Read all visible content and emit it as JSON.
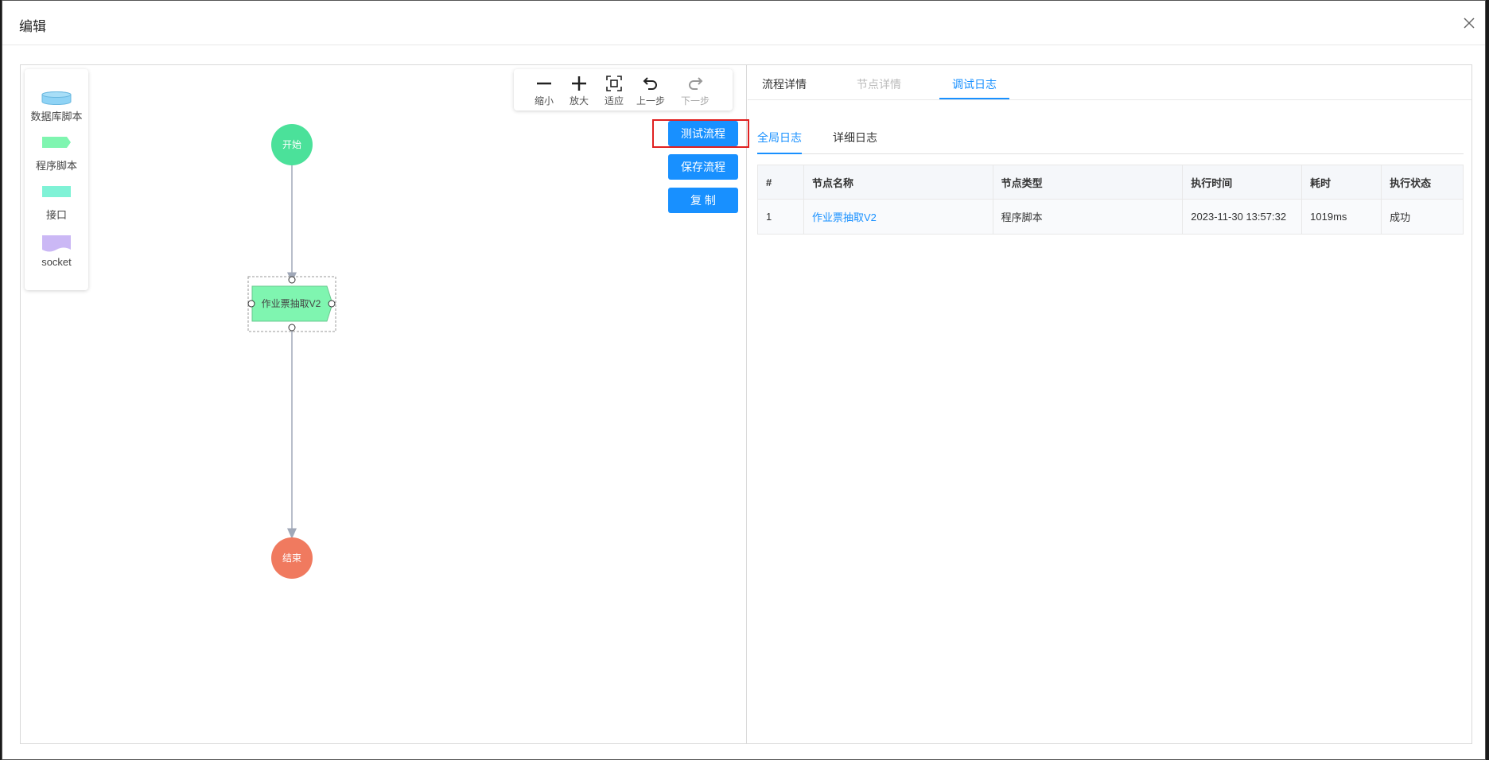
{
  "dialog": {
    "title": "编辑"
  },
  "palette": {
    "items": [
      {
        "label": "数据库脚本",
        "icon": "database-icon"
      },
      {
        "label": "程序脚本",
        "icon": "program-script-icon"
      },
      {
        "label": "接口",
        "icon": "interface-icon"
      },
      {
        "label": "socket",
        "icon": "socket-icon"
      }
    ]
  },
  "toolbar": {
    "zoom_out": "缩小",
    "zoom_in": "放大",
    "fit": "适应",
    "undo": "上一步",
    "redo": "下一步"
  },
  "actions": {
    "test_flow": "测试流程",
    "save_flow": "保存流程",
    "copy": "复 制"
  },
  "flow": {
    "start_label": "开始",
    "task_label": "作业票抽取V2",
    "end_label": "结束",
    "colors": {
      "start": "#4be19a",
      "task": "#7ff5b0",
      "end": "#f07a5f",
      "edge": "#a0a8b8"
    }
  },
  "panel": {
    "tabs": [
      "流程详情",
      "节点详情",
      "调试日志"
    ],
    "subtabs": [
      "全局日志",
      "详细日志"
    ],
    "table": {
      "headers": [
        "#",
        "节点名称",
        "节点类型",
        "执行时间",
        "耗时",
        "执行状态"
      ],
      "rows": [
        [
          "1",
          "作业票抽取V2",
          "程序脚本",
          "2023-11-30 13:57:32",
          "1019ms",
          "成功"
        ]
      ]
    }
  },
  "colors": {
    "accent": "#1890ff",
    "highlight": "#e02020"
  }
}
